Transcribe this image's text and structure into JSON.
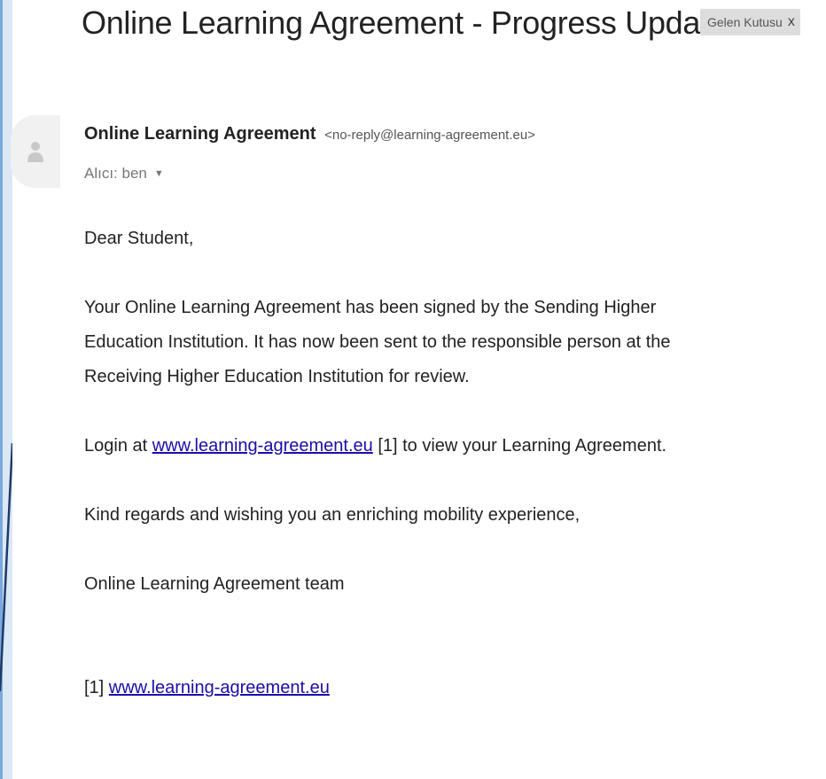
{
  "email": {
    "subject": "Online Learning Agreement - Progress Update",
    "label": {
      "text": "Gelen Kutusu",
      "close": "x"
    },
    "sender": {
      "name": "Online Learning Agreement",
      "email": "<no-reply@learning-agreement.eu>"
    },
    "recipient": {
      "text": "Alıcı: ben",
      "arrow": "▼"
    },
    "body": {
      "greeting": "Dear Student,",
      "paragraph1": [
        "Your Online Learning Agreement has been signed by the Sending Higher",
        "Education Institution. It has now been sent to the responsible person at the",
        "Receiving Higher Education Institution for review."
      ],
      "login_prefix": "Login at ",
      "login_link": "www.learning-agreement.eu",
      "login_suffix": " [1] to view your Learning Agreement.",
      "regards": "Kind regards and wishing you an enriching mobility experience,",
      "signature": "Online Learning Agreement team",
      "footnote_marker": "[1] ",
      "footnote_link": "www.learning-agreement.eu"
    }
  },
  "icons": {
    "avatar": "person-icon",
    "label_close": "close-icon",
    "recipient_details": "caret-down-icon"
  },
  "colors": {
    "link": "#1a0dab",
    "label_bg": "#dddddd",
    "decoration": "#4a88c7"
  }
}
